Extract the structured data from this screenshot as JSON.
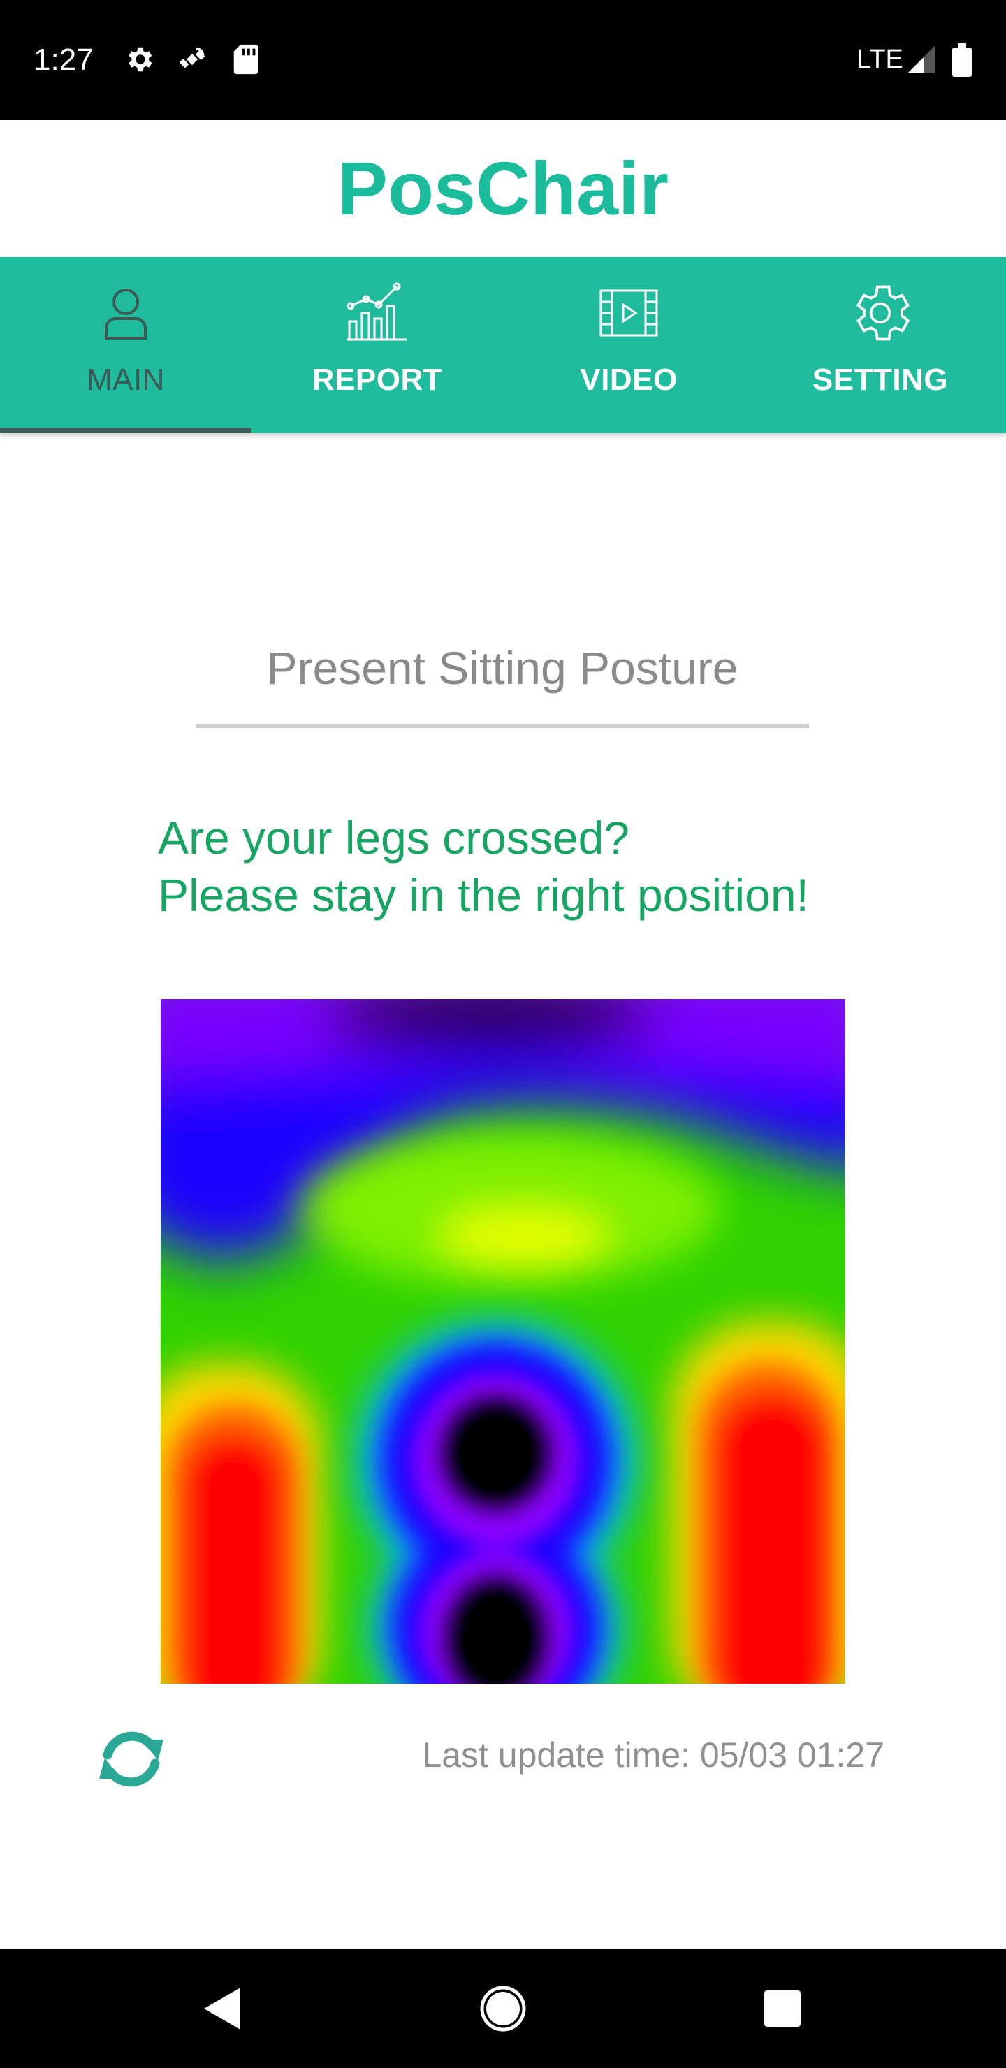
{
  "status_bar": {
    "time": "1:27",
    "network": "LTE",
    "icons": [
      "settings-gear-icon",
      "satellite-icon",
      "sd-card-icon",
      "signal-icon",
      "battery-icon"
    ]
  },
  "app": {
    "title": "PosChair",
    "accent_color": "#1fbb9d"
  },
  "tabs": [
    {
      "label": "MAIN",
      "icon": "person-icon",
      "active": true
    },
    {
      "label": "REPORT",
      "icon": "chart-icon",
      "active": false
    },
    {
      "label": "VIDEO",
      "icon": "film-icon",
      "active": false
    },
    {
      "label": "SETTING",
      "icon": "gear-icon",
      "active": false
    }
  ],
  "main": {
    "posture_label": "Present Sitting Posture",
    "message_line1": "Are your legs crossed?",
    "message_line2": "Please stay in the right position!",
    "last_update": "Last update time: 05/03 01:27",
    "refresh_icon": "refresh-icon"
  },
  "nav_bar": {
    "icons": [
      "back-icon",
      "home-icon",
      "recents-icon"
    ]
  }
}
